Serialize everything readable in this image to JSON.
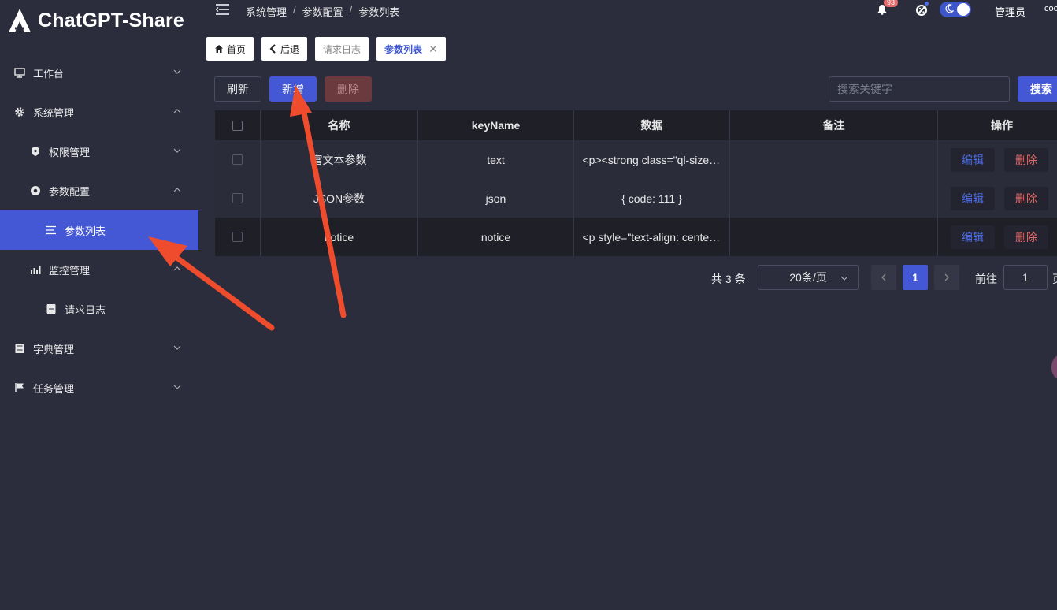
{
  "app": {
    "logo_text": "ChatGPT-Share"
  },
  "sidebar": {
    "items": [
      {
        "label": "工作台",
        "icon": "monitor-icon",
        "level": 1,
        "expanded": false
      },
      {
        "label": "系统管理",
        "icon": "gear-icon",
        "level": 1,
        "expanded": true
      },
      {
        "label": "权限管理",
        "icon": "shield-icon",
        "level": 2,
        "expanded": false
      },
      {
        "label": "参数配置",
        "icon": "circle-icon",
        "level": 2,
        "expanded": true
      },
      {
        "label": "参数列表",
        "icon": "list-icon",
        "level": 3,
        "active": true
      },
      {
        "label": "监控管理",
        "icon": "bar-chart-icon",
        "level": 2,
        "expanded": true
      },
      {
        "label": "请求日志",
        "icon": "document-icon",
        "level": 3
      },
      {
        "label": "字典管理",
        "icon": "book-icon",
        "level": 1,
        "expanded": false
      },
      {
        "label": "任务管理",
        "icon": "flag-icon",
        "level": 1,
        "expanded": false
      }
    ]
  },
  "header": {
    "breadcrumb": [
      "系统管理",
      "参数配置",
      "参数列表"
    ],
    "notification_count": "93",
    "user_name": "管理员",
    "user_extra": "coo"
  },
  "tags": [
    {
      "label": "首页",
      "icon": "home-icon"
    },
    {
      "label": "后退",
      "icon": "chevron-left-icon"
    },
    {
      "label": "请求日志"
    },
    {
      "label": "参数列表",
      "closable": true,
      "current": true
    }
  ],
  "toolbar": {
    "refresh_label": "刷新",
    "add_label": "新增",
    "delete_label": "删除",
    "search_placeholder": "搜索关键字",
    "search_label": "搜索"
  },
  "table": {
    "columns": [
      "名称",
      "keyName",
      "数据",
      "备注",
      "操作"
    ],
    "rows": [
      {
        "name": "富文本参数",
        "key": "text",
        "data": "<p><strong class=\"ql-size-large\">",
        "note": ""
      },
      {
        "name": "JSON参数",
        "key": "json",
        "data": "{ code: 111 }",
        "note": ""
      },
      {
        "name": "notice",
        "key": "notice",
        "data": "<p style=\"text-align: center;\">",
        "note": ""
      }
    ],
    "edit_label": "编辑",
    "delete_label": "删除"
  },
  "pagination": {
    "total_text": "共 3 条",
    "page_size": "20条/页",
    "current_page": "1",
    "goto_label": "前往",
    "goto_value": "1",
    "goto_suffix": "页"
  },
  "colors": {
    "accent": "#4458d6",
    "danger": "#e86b6b",
    "bg": "#2b2d3d",
    "annotation_arrow": "#ee4c2c"
  }
}
